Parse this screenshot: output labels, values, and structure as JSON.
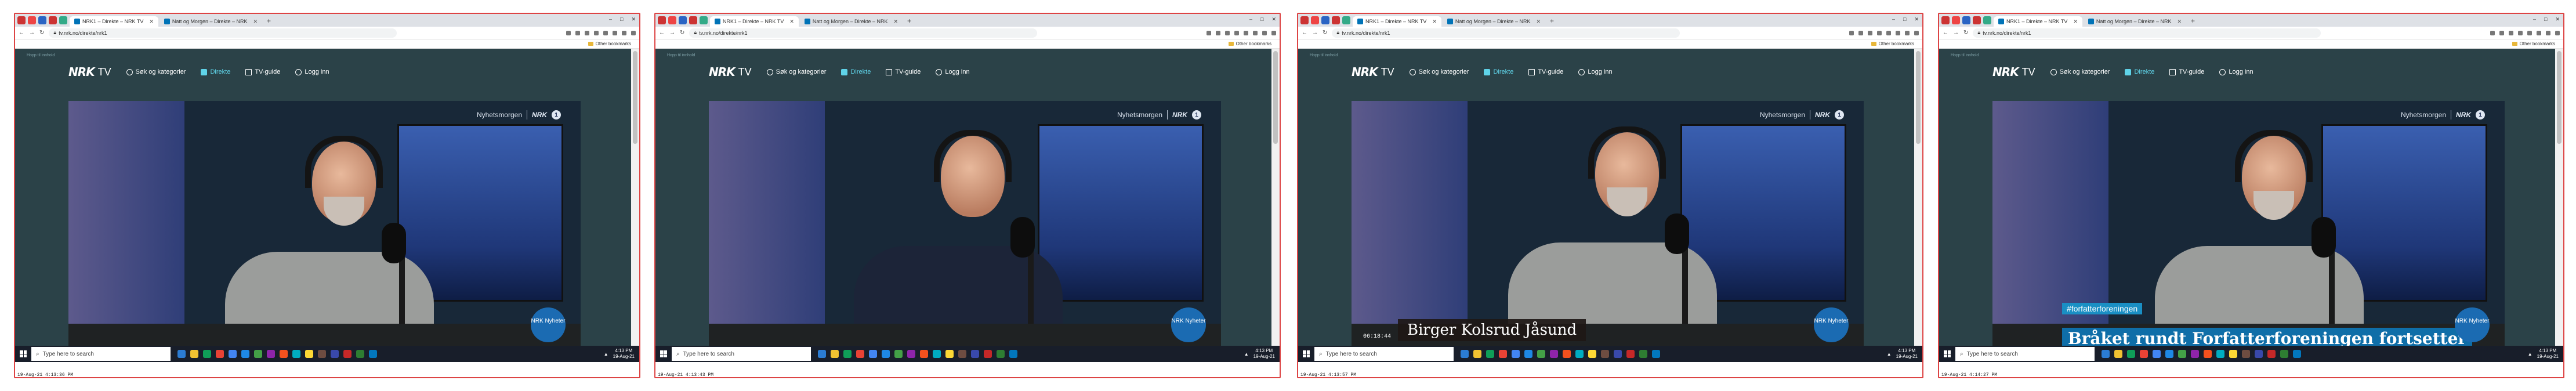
{
  "colors": {
    "page_bg": "#2b4248",
    "accent": "#5fd3e8",
    "frame": "#dd4444",
    "taskbar": "#181e2a"
  },
  "browser": {
    "tabs": [
      {
        "title": "NRK1 – Direkte – NRK TV",
        "active": true
      },
      {
        "title": "Natt og Morgen – Direkte – NRK",
        "active": false
      }
    ],
    "url": "tv.nrk.no/direkte/nrk1",
    "bookmarks_label": "Other bookmarks",
    "window_buttons": [
      "–",
      "□",
      "✕"
    ]
  },
  "nrk": {
    "skip_link": "Hopp til innhold",
    "logo_text": "NRK",
    "logo_suffix": "TV",
    "nav": [
      {
        "label": "Søk og kategorier",
        "icon": "search-icon"
      },
      {
        "label": "Direkte",
        "icon": "live-icon"
      },
      {
        "label": "TV-guide",
        "icon": "tv-guide-icon"
      },
      {
        "label": "Logg inn",
        "icon": "user-icon"
      }
    ],
    "channel_brand": "Nyhetsmorgen",
    "channel_logo": "NRK",
    "channel_number": "1"
  },
  "taskbar": {
    "search_placeholder": "Type here to search",
    "time": "4:13 PM",
    "date": "19-Aug-21"
  },
  "panels": [
    {
      "caption": "19-Aug-21 4:13:36 PM",
      "lower_third": "",
      "tag": "",
      "headline": "",
      "video_clock": "",
      "badge": "NRK Nyheter"
    },
    {
      "caption": "19-Aug-21 4:13:43 PM",
      "lower_third": "",
      "tag": "",
      "headline": "",
      "video_clock": "",
      "badge": "NRK Nyheter"
    },
    {
      "caption": "19-Aug-21 4:13:57 PM",
      "lower_third": "Birger Kolsrud Jåsund",
      "tag": "",
      "headline": "",
      "video_clock": "06:18:44",
      "badge": "NRK Nyheter"
    },
    {
      "caption": "19-Aug-21 4:14:27 PM",
      "lower_third": "",
      "tag": "#forfatterforeningen",
      "headline": "Bråket rundt Forfatterforeningen fortsetter",
      "video_clock": "",
      "badge": "NRK Nyheter"
    }
  ]
}
